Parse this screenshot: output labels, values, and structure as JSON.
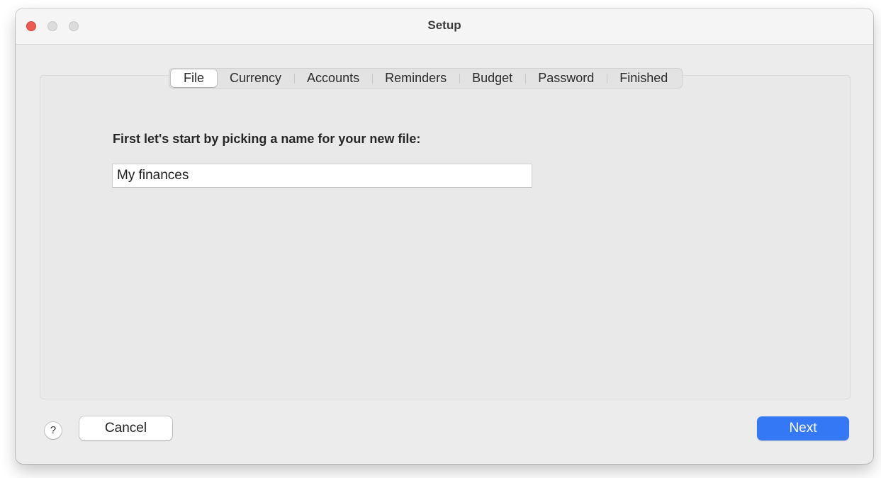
{
  "window": {
    "title": "Setup"
  },
  "tabs": [
    {
      "label": "File",
      "selected": true
    },
    {
      "label": "Currency",
      "selected": false
    },
    {
      "label": "Accounts",
      "selected": false
    },
    {
      "label": "Reminders",
      "selected": false
    },
    {
      "label": "Budget",
      "selected": false
    },
    {
      "label": "Password",
      "selected": false
    },
    {
      "label": "Finished",
      "selected": false
    }
  ],
  "main": {
    "prompt": "First let's start by picking a name for your new file:",
    "file_name_value": "My finances"
  },
  "footer": {
    "help_label": "?",
    "cancel_label": "Cancel",
    "next_label": "Next"
  },
  "colors": {
    "close_button": "#ee5a52",
    "accent": "#3478f6"
  },
  "icons": {
    "close": "close-traffic-light",
    "minimize": "minimize-traffic-light",
    "maximize": "zoom-traffic-light",
    "help": "question-mark-icon"
  }
}
